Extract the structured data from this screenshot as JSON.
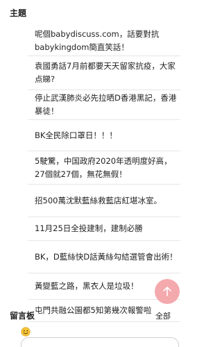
{
  "header": {
    "title": "主題"
  },
  "topics": [
    "呢個babydiscuss.com，話要對抗babykingdom簡直笑話！",
    "袁國勇話7月前都要天天留家抗疫，大家点睇?",
    "停止武漢肺炎必先拉晒D香港黑記，香港暴徒！",
    "BK全民除口罩日！！！",
    "5駛驚，中国政府2020年透明度好高，27個就27個，無花無假！",
    "招500萬沈默藍絲救藍店紅堪冰室。",
    "11月25日全投建制，建制必勝",
    "BK，D藍絲快D話黃絲勾結選管會出術！",
    "黃變藍之路，黑衣人是垃圾！",
    "屯門共融公園都5知第幾次報警啦"
  ],
  "guestbook": {
    "title": "留言板",
    "all_label": "全部"
  },
  "icons": {
    "fab": "arrow-up-icon",
    "emoji": "smiley-icon"
  },
  "colors": {
    "fab": "#f4a9ad",
    "divider": "#e6e6e6"
  }
}
